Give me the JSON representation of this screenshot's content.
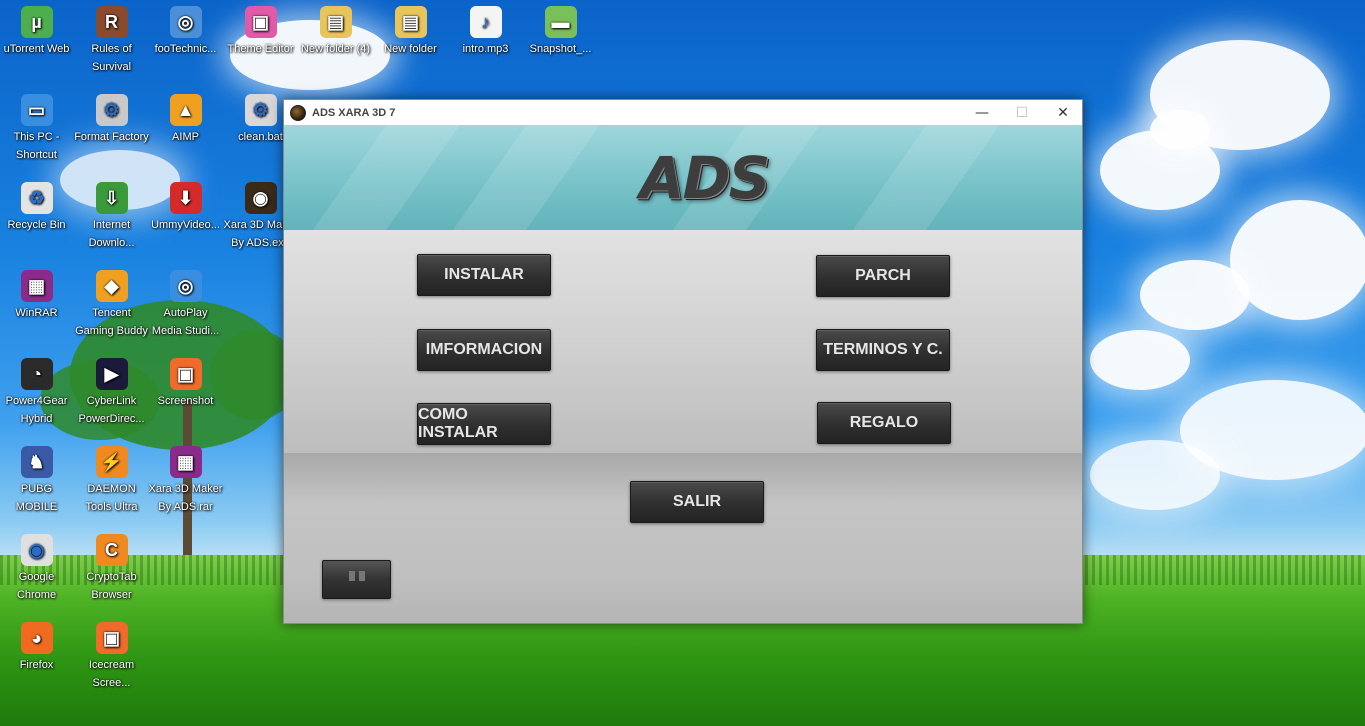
{
  "desktop": {
    "icons": [
      {
        "label": "uTorrent Web",
        "icon": "utorrent-icon",
        "color": "#4cae4c",
        "glyph": "µ"
      },
      {
        "label": "Rules of Survival",
        "icon": "rules-of-survival-icon",
        "color": "#8a4a2e",
        "glyph": "R"
      },
      {
        "label": "fooTechnic...",
        "icon": "cd-icon",
        "color": "#4a8fd8",
        "glyph": "◎"
      },
      {
        "label": "Theme Editor",
        "icon": "theme-editor-icon",
        "color": "#e05aa8",
        "glyph": "▣"
      },
      {
        "label": "New folder (4)",
        "icon": "folder-icon",
        "color": "#e8c55a",
        "glyph": "▤"
      },
      {
        "label": "New folder",
        "icon": "folder-icon",
        "color": "#e8c55a",
        "glyph": "▤"
      },
      {
        "label": "intro.mp3",
        "icon": "mp3-file-icon",
        "color": "#f4f4f4",
        "glyph": "♪"
      },
      {
        "label": "Snapshot_...",
        "icon": "image-file-icon",
        "color": "#7ac05a",
        "glyph": "▬"
      },
      {
        "label": "This PC - Shortcut",
        "icon": "this-pc-icon",
        "color": "#3a8ee0",
        "glyph": "▭"
      },
      {
        "label": "Format Factory",
        "icon": "format-factory-icon",
        "color": "#c9c9c9",
        "glyph": "⚙"
      },
      {
        "label": "AIMP",
        "icon": "aimp-icon",
        "color": "#f0a020",
        "glyph": "▲"
      },
      {
        "label": "clean.bat",
        "icon": "batch-file-icon",
        "color": "#d8d8d8",
        "glyph": "⚙"
      },
      {
        "label": "Recycle Bin",
        "icon": "recycle-bin-icon",
        "color": "#e4e4e4",
        "glyph": "♻"
      },
      {
        "label": "Internet Downlo...",
        "icon": "internet-download-manager-icon",
        "color": "#3a9a3a",
        "glyph": "⇩"
      },
      {
        "label": "UmmyVideo...",
        "icon": "ummy-video-icon",
        "color": "#d42a2a",
        "glyph": "⬇"
      },
      {
        "label": "Xara 3D Maker By ADS.exe",
        "icon": "xara-ads-icon",
        "color": "#3a2a18",
        "glyph": "◉"
      },
      {
        "label": "WinRAR",
        "icon": "winrar-icon",
        "color": "#8a2a8a",
        "glyph": "▦"
      },
      {
        "label": "Tencent Gaming Buddy",
        "icon": "tencent-gaming-buddy-icon",
        "color": "#f0a020",
        "glyph": "◆"
      },
      {
        "label": "AutoPlay Media Studi...",
        "icon": "autoplay-media-studio-icon",
        "color": "#3a8ee0",
        "glyph": "◎"
      },
      {
        "label": "Power4Gear Hybrid",
        "icon": "power4gear-icon",
        "color": "#2a2a2a",
        "glyph": "◔"
      },
      {
        "label": "CyberLink PowerDirec...",
        "icon": "powerdirector-icon",
        "color": "#1a1a3a",
        "glyph": "▶"
      },
      {
        "label": "Screenshot",
        "icon": "screenshot-icon",
        "color": "#f06a2a",
        "glyph": "▣"
      },
      {
        "label": "PUBG MOBILE",
        "icon": "pubg-mobile-icon",
        "color": "#3a5aa8",
        "glyph": "♞"
      },
      {
        "label": "DAEMON Tools Ultra",
        "icon": "daemon-tools-icon",
        "color": "#f08a20",
        "glyph": "⚡"
      },
      {
        "label": "Xara 3D Maker By ADS.rar",
        "icon": "rar-archive-icon",
        "color": "#8a2a8a",
        "glyph": "▦"
      },
      {
        "label": "Google Chrome",
        "icon": "chrome-icon",
        "color": "#e0e0e0",
        "glyph": "◉"
      },
      {
        "label": "CryptoTab Browser",
        "icon": "cryptotab-icon",
        "color": "#f08a20",
        "glyph": "C"
      },
      {
        "label": "Firefox",
        "icon": "firefox-icon",
        "color": "#f06a20",
        "glyph": "◕"
      },
      {
        "label": "Icecream Scree...",
        "icon": "icecream-screen-recorder-icon",
        "color": "#f06a2a",
        "glyph": "▣"
      }
    ]
  },
  "window": {
    "title": "ADS XARA 3D 7",
    "controls": {
      "minimize": "—",
      "maximize": "☐",
      "close": "✕"
    },
    "logo_text": "ADS",
    "banner_color": "#78c3c9",
    "buttons": {
      "instalar": "INSTALAR",
      "parch": "PARCH",
      "informacion": "IMFORMACION",
      "terminos": "TERMINOS Y C.",
      "como_instalar": "COMO INSTALAR",
      "regalo": "REGALO",
      "salir": "SALIR"
    },
    "pause_icon": "pause-icon"
  }
}
